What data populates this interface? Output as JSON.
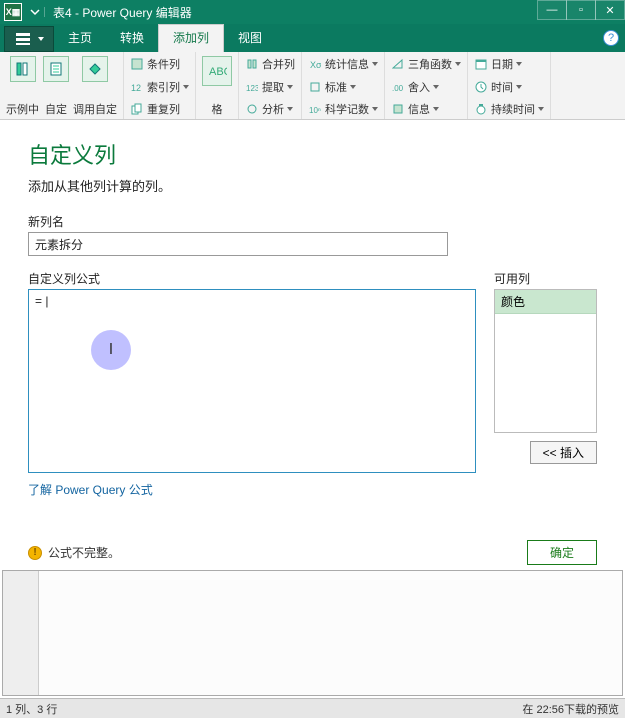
{
  "title": "表4 - Power Query 编辑器",
  "app_icon": "X▦",
  "window_controls": {
    "min": "—",
    "max": "▫",
    "close": "✕"
  },
  "tabs": [
    "主页",
    "转换",
    "添加列",
    "视图"
  ],
  "active_tab_index": 2,
  "ribbon": {
    "g1": [
      "示例中",
      "自定",
      "调用自定"
    ],
    "col1": [
      "条件列",
      "索引列",
      "重复列"
    ],
    "g2": "格",
    "col2": [
      "合并列",
      "提取",
      "分析"
    ],
    "col3": [
      "统计信息",
      "标准",
      "科学记数"
    ],
    "col4": [
      "三角函数",
      "舍入",
      "信息"
    ],
    "col5": [
      "日期",
      "时间",
      "持续时间"
    ]
  },
  "dialog": {
    "title": "自定义列",
    "subtitle": "添加从其他列计算的列。",
    "name_label": "新列名",
    "name_value": "元素拆分",
    "formula_label": "自定义列公式",
    "formula_value": "= |",
    "avail_label": "可用列",
    "avail_items": [
      "颜色"
    ],
    "insert": "<< 插入",
    "link": "了解 Power Query 公式",
    "warning": "公式不完整。",
    "ok": "确定"
  },
  "statusbar": {
    "left": "1 列、3 行",
    "right": "在 22:56下载的预览"
  }
}
